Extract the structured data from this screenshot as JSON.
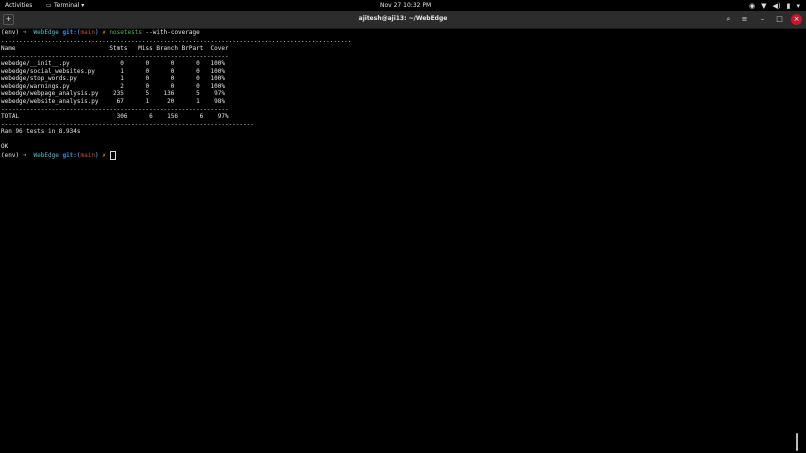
{
  "topbar": {
    "activities": "Activities",
    "app_menu": "Terminal ▾",
    "clock": "Nov 27  10:32 PM",
    "tray_icons": [
      "discord-icon",
      "wifi-icon",
      "volume-icon",
      "battery-icon",
      "power-menu-icon"
    ]
  },
  "window": {
    "title": "ajitesh@aji13: ~/WebEdge",
    "buttons": [
      "new-tab-icon",
      "search-icon",
      "menu-icon",
      "minimize-icon",
      "maximize-icon",
      "close-icon"
    ]
  },
  "terminal": {
    "prompt1": {
      "env": "(env) ",
      "arrow": "➜  ",
      "dir": "WebEdge ",
      "git": "git:(",
      "branch": "main",
      "git_end": ") ",
      "x": "✗ ",
      "cmd": "nosetests",
      "args": " --with-coverage"
    },
    "sep_dot": ".................................................................................................",
    "sep_dash": "---------------------------------------------------------------",
    "header": "Name                          Stmts   Miss Branch BrPart  Cover",
    "rows": [
      "webedge/__init__.py              0      0      0      0   100%",
      "webedge/social_websites.py       1      0      0      0   100%",
      "webedge/stop_words.py            1      0      0      0   100%",
      "webedge/warnings.py              2      0      0      0   100%",
      "webedge/webpage_analysis.py    235      5    136      5    97%",
      "webedge/website_analysis.py     67      1     20      1    98%"
    ],
    "total": "TOTAL                           306      6    156      6    97%",
    "sep_dash2": "----------------------------------------------------------------------",
    "ran": "Ran 96 tests in 8.934s",
    "ok": "OK",
    "prompt2": {
      "env": "(env) ",
      "arrow": "➜  ",
      "dir": "WebEdge ",
      "git": "git:(",
      "branch": "main",
      "git_end": ") ",
      "x": "✗ "
    }
  }
}
